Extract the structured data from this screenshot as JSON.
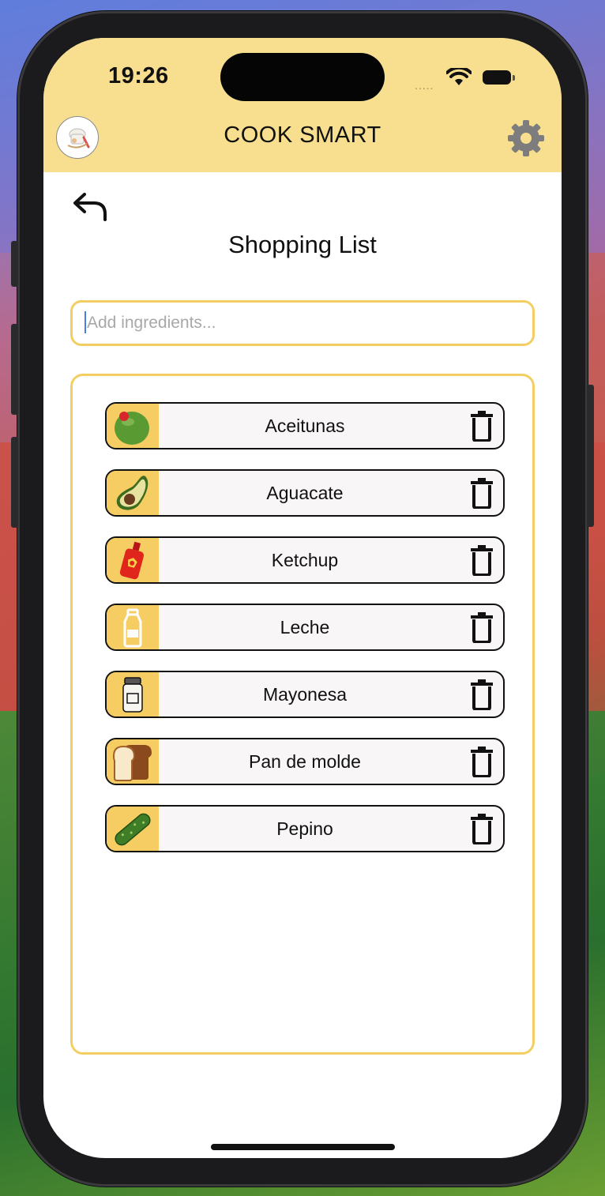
{
  "status_bar": {
    "time": "19:26",
    "signal": "....."
  },
  "header": {
    "app_title": "COOK SMART",
    "avatar_icon": "chef-avatar-icon",
    "settings_icon": "gear-icon",
    "background_color": "#f8df8f"
  },
  "page": {
    "back_icon": "back-arrow-icon",
    "title": "Shopping List"
  },
  "search": {
    "placeholder": "Add ingredients...",
    "value": ""
  },
  "shopping_list": {
    "items": [
      {
        "label": "Aceitunas",
        "icon": "olive-icon"
      },
      {
        "label": "Aguacate",
        "icon": "avocado-icon"
      },
      {
        "label": "Ketchup",
        "icon": "ketchup-icon"
      },
      {
        "label": "Leche",
        "icon": "milk-bottle-icon"
      },
      {
        "label": "Mayonesa",
        "icon": "mayonnaise-jar-icon"
      },
      {
        "label": "Pan de molde",
        "icon": "bread-icon"
      },
      {
        "label": "Pepino",
        "icon": "cucumber-icon"
      }
    ],
    "delete_icon": "trash-icon"
  },
  "colors": {
    "accent": "#f3cf63",
    "thumb_background": "#f6cd63"
  }
}
